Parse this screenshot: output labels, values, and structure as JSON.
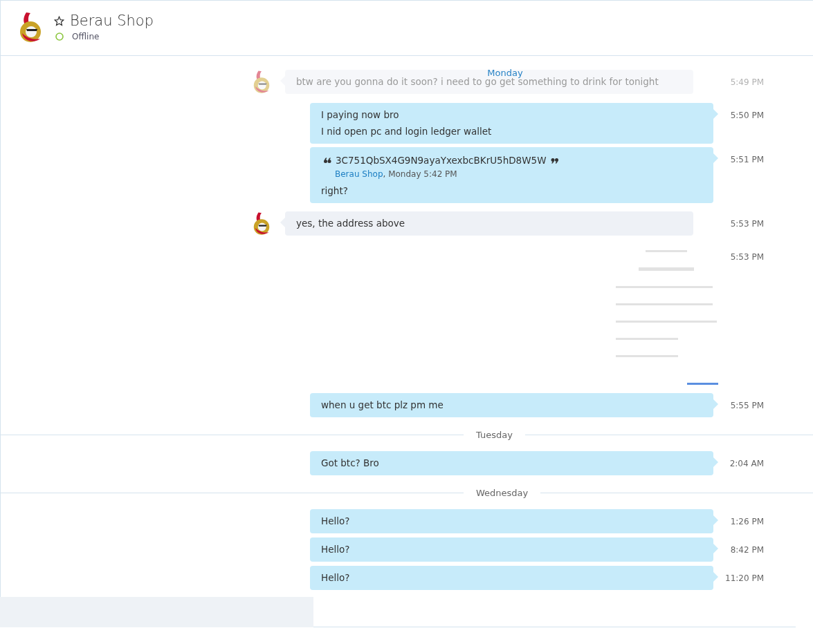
{
  "header": {
    "title": "Berau Shop",
    "favorite": false,
    "status": "Offline"
  },
  "sticky_day": "Monday",
  "timeline": [
    {
      "kind": "incoming",
      "faded": true,
      "lines": [
        "btw are you gonna do it soon? i need to go get something to drink for tonight"
      ],
      "time": "5:49 PM"
    },
    {
      "kind": "outgoing",
      "faded": false,
      "lines": [
        "I paying now bro",
        "I nid open pc and login ledger wallet"
      ],
      "time": "5:50 PM"
    },
    {
      "kind": "outgoing",
      "faded": false,
      "quote": {
        "text": "3C751QbSX4G9N9ayaYxexbcBKrU5hD8W5W",
        "author": "Berau Shop",
        "meta": ", Monday 5:42 PM"
      },
      "lines": [
        "right?"
      ],
      "time": "5:51 PM"
    },
    {
      "kind": "incoming",
      "faded": false,
      "lines": [
        "yes, the address above"
      ],
      "time": "5:53 PM"
    },
    {
      "kind": "image",
      "faded": false,
      "time": "5:53 PM"
    },
    {
      "kind": "outgoing",
      "faded": false,
      "lines": [
        "when u get btc plz pm me"
      ],
      "time": "5:55 PM"
    },
    {
      "kind": "day",
      "label": "Tuesday"
    },
    {
      "kind": "outgoing",
      "faded": false,
      "lines": [
        "Got btc? Bro"
      ],
      "time": "2:04 AM"
    },
    {
      "kind": "day",
      "label": "Wednesday"
    },
    {
      "kind": "outgoing",
      "faded": false,
      "lines": [
        "Hello?"
      ],
      "time": "1:26 PM"
    },
    {
      "kind": "outgoing",
      "faded": false,
      "lines": [
        "Hello?"
      ],
      "time": "8:42 PM"
    },
    {
      "kind": "outgoing",
      "faded": false,
      "lines": [
        "Hello?"
      ],
      "time": "11:20 PM"
    }
  ]
}
